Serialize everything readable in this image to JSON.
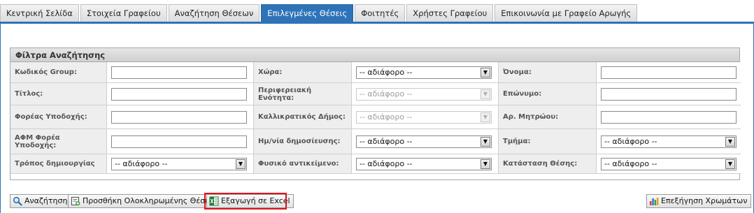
{
  "tabs": [
    {
      "label": "Κεντρική Σελίδα"
    },
    {
      "label": "Στοιχεία Γραφείου"
    },
    {
      "label": "Αναζήτηση Θέσεων"
    },
    {
      "label": "Επιλεγμένες Θέσεις",
      "active": true
    },
    {
      "label": "Φοιτητές"
    },
    {
      "label": "Χρήστες Γραφείου"
    },
    {
      "label": "Επικοινωνία με Γραφείο Αρωγής"
    }
  ],
  "filters": {
    "title": "Φίλτρα Αναζήτησης",
    "rows": [
      [
        {
          "label": "Κωδικός Group:",
          "type": "text",
          "value": ""
        },
        {
          "label": "Χώρα:",
          "type": "select",
          "value": "-- αδιάφορο --"
        },
        {
          "label": "Όνομα:",
          "type": "text",
          "value": ""
        }
      ],
      [
        {
          "label": "Τίτλος:",
          "type": "text",
          "value": ""
        },
        {
          "label": "Περιφερειακή Ενότητα:",
          "type": "select",
          "value": "-- αδιάφορο --",
          "disabled": true
        },
        {
          "label": "Επώνυμο:",
          "type": "text",
          "value": ""
        }
      ],
      [
        {
          "label": "Φορέας Υποδοχής:",
          "type": "text",
          "value": ""
        },
        {
          "label": "Καλλικρατικός Δήμος:",
          "type": "select",
          "value": "-- αδιάφορο --",
          "disabled": true
        },
        {
          "label": "Αρ. Μητρώου:",
          "type": "text",
          "value": ""
        }
      ],
      [
        {
          "label": "ΑΦΜ Φορέα Υποδοχής:",
          "type": "text",
          "value": ""
        },
        {
          "label": "Ημ/νία δημοσίευσης:",
          "type": "select",
          "value": "-- αδιάφορο --"
        },
        {
          "label": "Τμήμα:",
          "type": "select",
          "value": "-- αδιάφορο --"
        }
      ],
      [
        {
          "label": "Τρόπος δημιουργίας",
          "type": "select",
          "value": "-- αδιάφορο --"
        },
        {
          "label": "Φυσικό αντικείμενο:",
          "type": "select",
          "value": "-- αδιάφορο --"
        },
        {
          "label": "Κατάσταση Θέσης:",
          "type": "select",
          "value": "-- αδιάφορο --"
        }
      ]
    ]
  },
  "buttons": {
    "search": "Αναζήτηση",
    "add_completed": "Προσθήκη Ολοκληρωμένης Θέσης",
    "export_excel": "Εξαγωγή σε Excel",
    "colors_legend": "Επεξήγηση Χρωμάτων"
  },
  "colors": {
    "accent": "#2e73b8",
    "highlight": "#e0131b"
  }
}
